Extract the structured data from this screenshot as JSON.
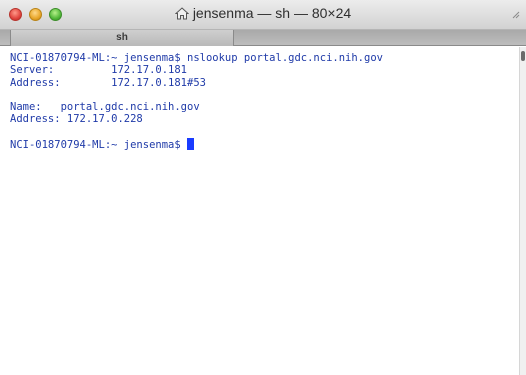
{
  "window": {
    "title": "jensenma — sh — 80×24"
  },
  "tabs": [
    {
      "label": "sh"
    }
  ],
  "terminal": {
    "lines": [
      "NCI-01870794-ML:~ jensenma$ nslookup portal.gdc.nci.nih.gov",
      "Server:         172.17.0.181",
      "Address:        172.17.0.181#53",
      "",
      "Name:   portal.gdc.nci.nih.gov",
      "Address: 172.17.0.228",
      "",
      "NCI-01870794-ML:~ jensenma$ "
    ]
  },
  "icons": {
    "home": "home-icon",
    "resize": "resize-icon"
  },
  "colors": {
    "text": "#1f3aa8",
    "cursor": "#1a3cff",
    "close": "#e0443e",
    "minimize": "#e8a62a",
    "maximize": "#52b83a"
  }
}
